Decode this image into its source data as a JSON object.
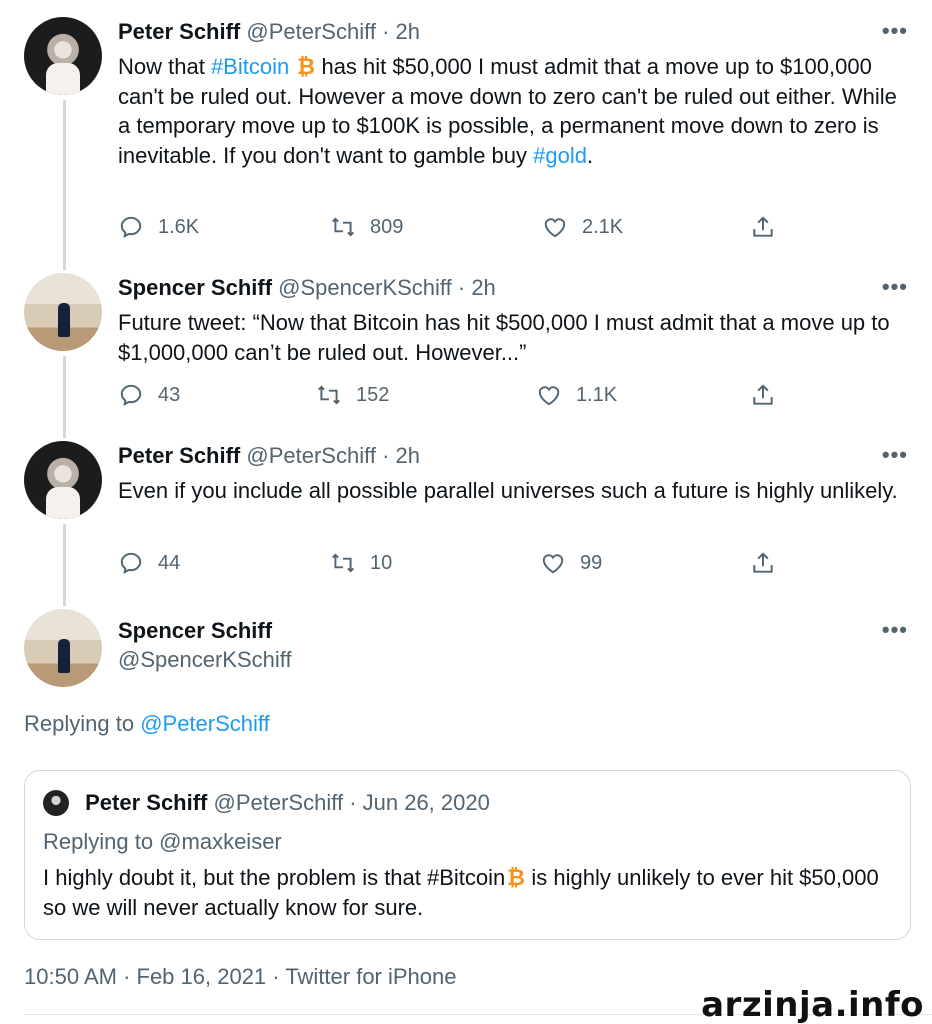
{
  "tweets": [
    {
      "name": "Peter Schiff",
      "handle": "@PeterSchiff",
      "time": "· 2h",
      "body_parts": [
        "Now that ",
        "#Bitcoin",
        " has hit $50,000 I must admit that a move up to $100,000 can't be ruled out. However a move down to zero can't be ruled out either. While a temporary move up to $100K is possible, a permanent move down to zero is inevitable. If you don't want to gamble buy ",
        "#gold",
        "."
      ],
      "replies": "1.6K",
      "retweets": "809",
      "likes": "2.1K"
    },
    {
      "name": "Spencer Schiff",
      "handle": "@SpencerKSchiff",
      "time": "· 2h",
      "body": "Future tweet: “Now that Bitcoin has hit $500,000 I must admit that a move up to $1,000,000 can’t be ruled out. However...”",
      "replies": "43",
      "retweets": "152",
      "likes": "1.1K"
    },
    {
      "name": "Peter Schiff",
      "handle": "@PeterSchiff",
      "time": "· 2h",
      "body": "Even if you include all possible parallel universes such a future is highly unlikely.",
      "replies": "44",
      "retweets": "10",
      "likes": "99"
    }
  ],
  "main_tweet": {
    "name": "Spencer Schiff",
    "handle": "@SpencerKSchiff",
    "replying_prefix": "Replying to ",
    "replying_to": "@PeterSchiff"
  },
  "quote": {
    "name": "Peter Schiff",
    "handle": "@PeterSchiff",
    "date": "· Jun 26, 2020",
    "replying": "Replying to @maxkeiser",
    "body_before": "I highly doubt it, but the problem is that #Bitcoin",
    "body_after": " is highly unlikely to ever hit $50,000 so we will never actually know for sure."
  },
  "footer": "10:50 AM · Feb 16, 2021 · Twitter for iPhone",
  "more_label": "•••",
  "watermark": "arzinja.info",
  "colors": {
    "link": "#1d9bf0",
    "muted": "#536471",
    "bitcoin": "#f7931a"
  },
  "icons": [
    "reply-icon",
    "retweet-icon",
    "like-icon",
    "share-icon",
    "bitcoin-icon",
    "more-icon"
  ]
}
